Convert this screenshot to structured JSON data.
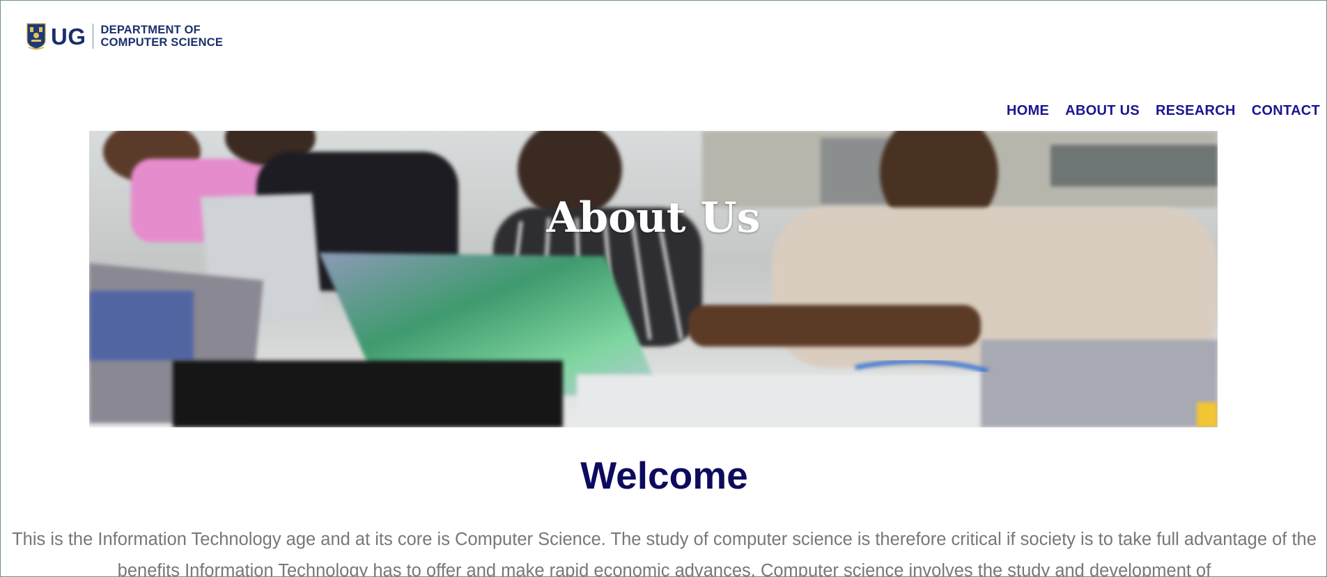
{
  "header": {
    "logo_abbr": "UG",
    "logo_line1": "DEPARTMENT OF",
    "logo_line2": "COMPUTER SCIENCE"
  },
  "nav": {
    "items": [
      {
        "label": "HOME"
      },
      {
        "label": "ABOUT US"
      },
      {
        "label": "RESEARCH"
      },
      {
        "label": "CONTACT"
      }
    ]
  },
  "hero": {
    "title": "About Us",
    "image_icon": "students-with-laptops-photo"
  },
  "main": {
    "heading": "Welcome",
    "intro": "This is the Information Technology age and at its core is Computer Science. The study of computer science is therefore critical if society is to take full advantage of the benefits Information Technology has to offer and make rapid economic advances. Computer science involves the study and development of"
  },
  "colors": {
    "nav_text": "#1b1690",
    "heading": "#0d0b5e",
    "body_text": "#777777",
    "logo_blue": "#1a2f6b"
  }
}
